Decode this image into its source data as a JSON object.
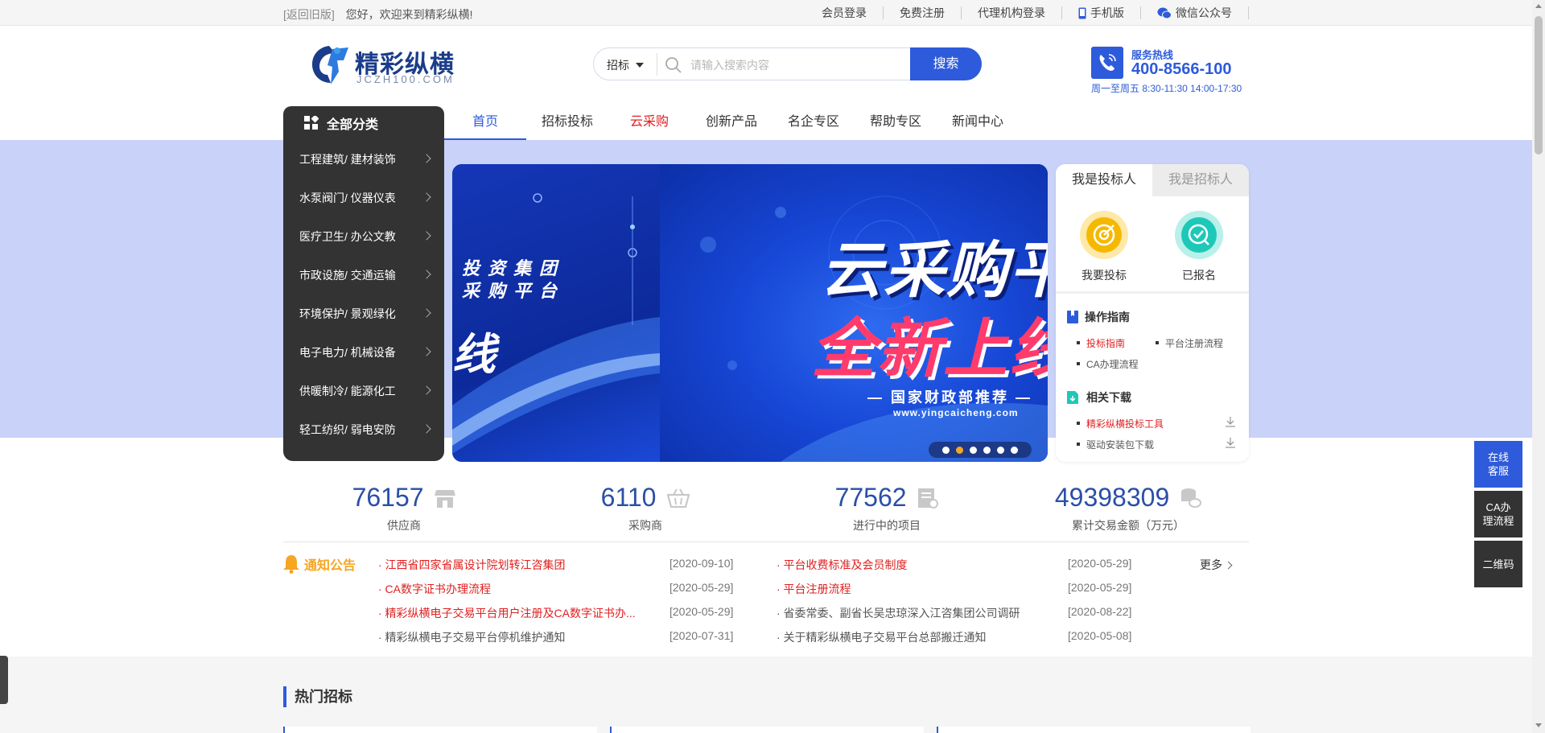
{
  "topbar": {
    "return_old": "[返回旧版]",
    "welcome": "您好，欢迎来到精彩纵横!",
    "links": [
      "会员登录",
      "免费注册",
      "代理机构登录",
      "手机版",
      "微信公众号"
    ]
  },
  "logo": {
    "cn": "精彩纵横",
    "en": "JCZH100.COM"
  },
  "search": {
    "type": "招标",
    "placeholder": "请输入搜索内容",
    "button": "搜索"
  },
  "hotline": {
    "label": "服务热线",
    "number": "400-8566-100",
    "hours": "周一至周五 8:30-11:30 14:00-17:30"
  },
  "nav": {
    "all_categories": "全部分类",
    "links": [
      "首页",
      "招标投标",
      "云采购",
      "创新产品",
      "名企专区",
      "帮助专区",
      "新闻中心"
    ]
  },
  "categories": [
    "工程建筑/ 建材装饰",
    "水泵阀门/ 仪器仪表",
    "医疗卫生/ 办公文教",
    "市政设施/ 交通运输",
    "环境保护/ 景观绿化",
    "电子电力/ 机械设备",
    "供暖制冷/ 能源化工",
    "轻工纺织/ 弱电安防"
  ],
  "banner": {
    "left_line1": "投资集团",
    "left_line2": "采购平台",
    "left_line3": "线",
    "title1": "云采购平",
    "title2": "全新上线",
    "subtitle": "— 国家财政部推荐 —",
    "url": "www.yingcaicheng.com",
    "active_dot": 2,
    "dot_count": 6
  },
  "role_panel": {
    "tabs": [
      "我是投标人",
      "我是招标人"
    ],
    "actions": [
      "我要投标",
      "已报名"
    ],
    "guide_title": "操作指南",
    "guide_items": [
      "投标指南",
      "平台注册流程",
      "CA办理流程"
    ],
    "download_title": "相关下载",
    "download_items": [
      "精彩纵横投标工具",
      "驱动安装包下载"
    ]
  },
  "stats": [
    {
      "value": "76157",
      "label": "供应商",
      "icon": "store-icon"
    },
    {
      "value": "6110",
      "label": "采购商",
      "icon": "basket-icon"
    },
    {
      "value": "77562",
      "label": "进行中的项目",
      "icon": "document-icon"
    },
    {
      "value": "49398309",
      "label": "累计交易金额（万元）",
      "icon": "coins-icon"
    }
  ],
  "notices": {
    "title": "通知公告",
    "more": "更多",
    "left": [
      {
        "text": "· 江西省四家省属设计院划转江咨集团",
        "date": "[2020-09-10]",
        "hot": true
      },
      {
        "text": "· CA数字证书办理流程",
        "date": "[2020-05-29]",
        "hot": true
      },
      {
        "text": "· 精彩纵横电子交易平台用户注册及CA数字证书办...",
        "date": "[2020-05-29]",
        "hot": true
      },
      {
        "text": "· 精彩纵横电子交易平台停机维护通知",
        "date": "[2020-07-31]",
        "hot": false
      }
    ],
    "right": [
      {
        "text": "· 平台收费标准及会员制度",
        "date": "[2020-05-29]",
        "hot": true
      },
      {
        "text": "· 平台注册流程",
        "date": "[2020-05-29]",
        "hot": true
      },
      {
        "text": "· 省委常委、副省长吴忠琼深入江咨集团公司调研",
        "date": "[2020-08-22]",
        "hot": false
      },
      {
        "text": "· 关于精彩纵横电子交易平台总部搬迁通知",
        "date": "[2020-05-08]",
        "hot": false
      }
    ]
  },
  "hot_bidding": {
    "title": "热门招标"
  },
  "side_buttons": [
    "在线客服",
    "CA办理流程",
    "二维码"
  ],
  "colors": {
    "brand": "#2d5bdb",
    "hot": "#e02020",
    "notice": "#f5a623"
  }
}
